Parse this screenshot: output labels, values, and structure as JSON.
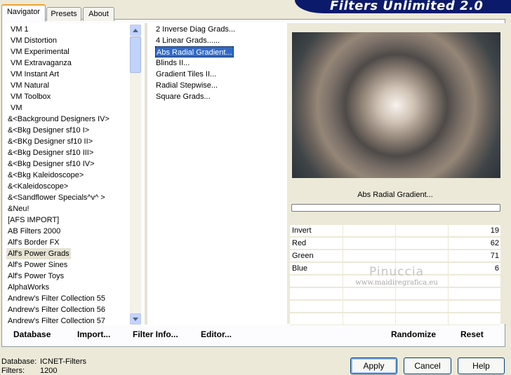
{
  "window": {
    "banner": "Filters Unlimited 2.0",
    "tabs": [
      {
        "label": "Navigator",
        "active": true
      },
      {
        "label": "Presets",
        "active": false
      },
      {
        "label": "About",
        "active": false
      }
    ]
  },
  "categories": {
    "items": [
      "VM 1",
      "VM Distortion",
      "VM Experimental",
      "VM Extravaganza",
      "VM Instant Art",
      "VM Natural",
      "VM Toolbox",
      "VM",
      "&<Background Designers IV>",
      "&<Bkg Designer sf10 I>",
      "&<BKg Designer sf10 II>",
      "&<Bkg Designer sf10 III>",
      "&<Bkg Designer sf10 IV>",
      "&<Bkg Kaleidoscope>",
      "&<Kaleidoscope>",
      "&<Sandflower Specials^v^ >",
      "&Neu!",
      "[AFS IMPORT]",
      "AB Filters 2000",
      "Alf's Border FX",
      "Alf's Power Grads",
      "Alf's Power Sines",
      "Alf's Power Toys",
      "AlphaWorks",
      "Andrew's Filter Collection 55",
      "Andrew's Filter Collection 56",
      "Andrew's Filter Collection 57"
    ],
    "selected_index": 20
  },
  "filters": {
    "items": [
      "2 Inverse Diag Grads...",
      "4 Linear Grads......",
      "Abs Radial Gradient...",
      "Blinds II...",
      "Gradient Tiles II...",
      "Radial Stepwise...",
      "Square Grads..."
    ],
    "selected_index": 2
  },
  "preview": {
    "filter_name": "Abs Radial Gradient...",
    "params": [
      {
        "name": "Invert",
        "value": "19"
      },
      {
        "name": "Red",
        "value": "62"
      },
      {
        "name": "Green",
        "value": "71"
      },
      {
        "name": "Blue",
        "value": "6"
      }
    ],
    "watermark_name": "Pinuccia",
    "watermark_url": "www.maidiregrafica.eu"
  },
  "toolbar": {
    "database": "Database",
    "import": "Import...",
    "filter_info": "Filter Info...",
    "editor": "Editor...",
    "randomize": "Randomize",
    "reset": "Reset"
  },
  "status": {
    "database_label": "Database:",
    "database_value": "ICNET-Filters",
    "filters_label": "Filters:",
    "filters_value": "1200"
  },
  "buttons": {
    "apply": "Apply",
    "cancel": "Cancel",
    "help": "Help"
  }
}
